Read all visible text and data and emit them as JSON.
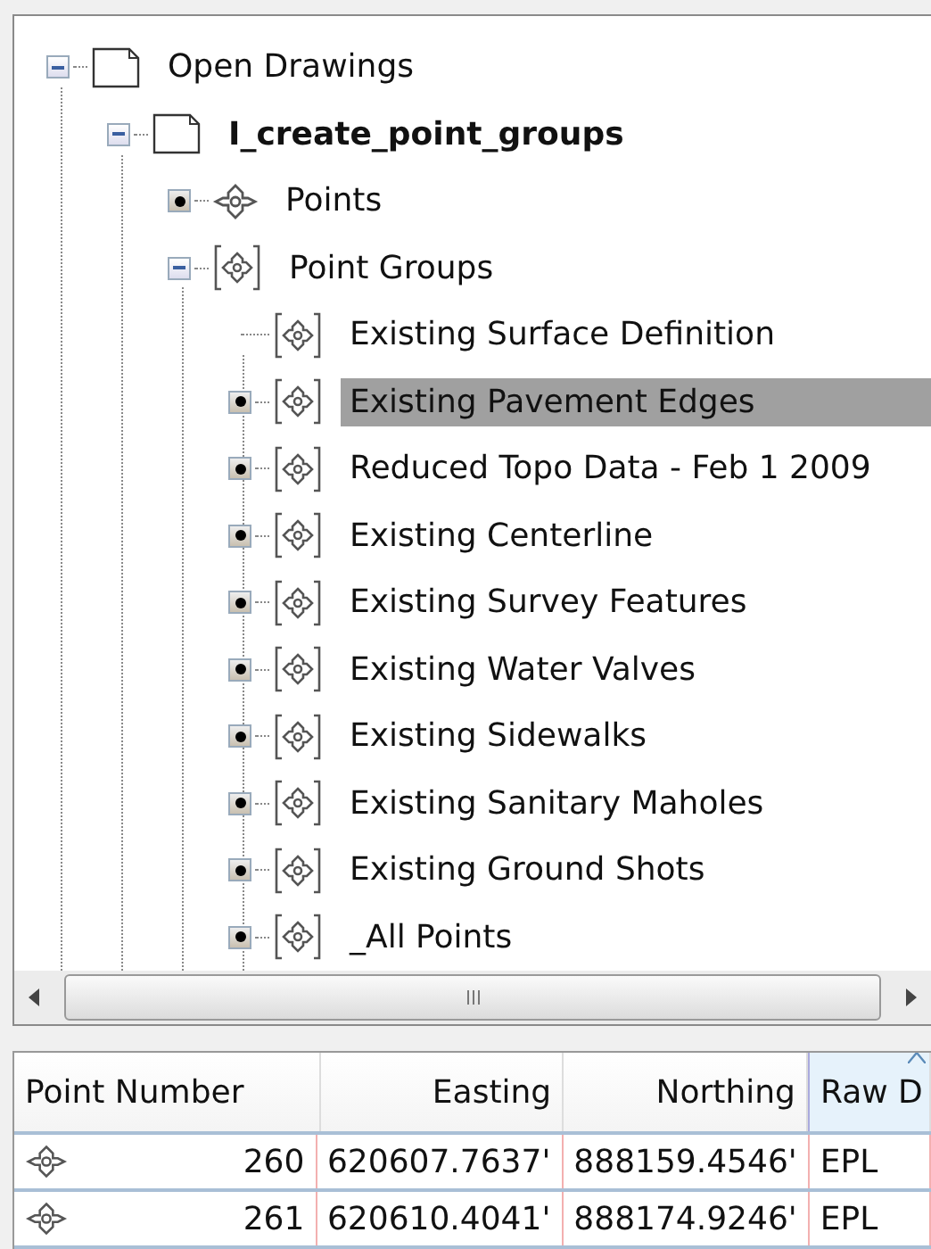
{
  "tree": [
    {
      "label": "Open Drawings",
      "kind": "drawing",
      "expanded": true,
      "bold": false,
      "selected": false,
      "children": [
        {
          "label": "I_create_point_groups",
          "kind": "drawing",
          "expanded": true,
          "bold": true,
          "selected": false,
          "children": [
            {
              "label": "Points",
              "kind": "points",
              "expanded": false,
              "bold": false,
              "selected": false
            },
            {
              "label": "Point Groups",
              "kind": "group",
              "expanded": true,
              "bold": false,
              "selected": false,
              "children": [
                {
                  "label": "Existing Surface Definition",
                  "kind": "group",
                  "bold": false,
                  "selected": false
                },
                {
                  "label": "Existing Pavement Edges",
                  "kind": "group",
                  "expanded": false,
                  "bold": false,
                  "selected": true
                },
                {
                  "label": "Reduced Topo Data - Feb 1 2009",
                  "kind": "group",
                  "expanded": false,
                  "bold": false,
                  "selected": false
                },
                {
                  "label": "Existing Centerline",
                  "kind": "group",
                  "expanded": false,
                  "bold": false,
                  "selected": false
                },
                {
                  "label": "Existing Survey Features",
                  "kind": "group",
                  "expanded": false,
                  "bold": false,
                  "selected": false
                },
                {
                  "label": "Existing Water Valves",
                  "kind": "group",
                  "expanded": false,
                  "bold": false,
                  "selected": false
                },
                {
                  "label": "Existing Sidewalks",
                  "kind": "group",
                  "expanded": false,
                  "bold": false,
                  "selected": false
                },
                {
                  "label": "Existing Sanitary Maholes",
                  "kind": "group",
                  "expanded": false,
                  "bold": false,
                  "selected": false
                },
                {
                  "label": "Existing Ground Shots",
                  "kind": "group",
                  "expanded": false,
                  "bold": false,
                  "selected": false
                },
                {
                  "label": "_All Points",
                  "kind": "group",
                  "expanded": false,
                  "bold": false,
                  "selected": false
                }
              ]
            }
          ]
        }
      ]
    }
  ],
  "table": {
    "columns": [
      {
        "label": "Point Number",
        "sorted": false
      },
      {
        "label": "Easting",
        "sorted": false
      },
      {
        "label": "Northing",
        "sorted": false
      },
      {
        "label": "Raw D",
        "sorted": true
      }
    ],
    "rows": [
      [
        "260",
        "620607.7637'",
        "888159.4546'",
        "EPL"
      ],
      [
        "261",
        "620610.4041'",
        "888174.9246'",
        "EPL"
      ]
    ]
  }
}
